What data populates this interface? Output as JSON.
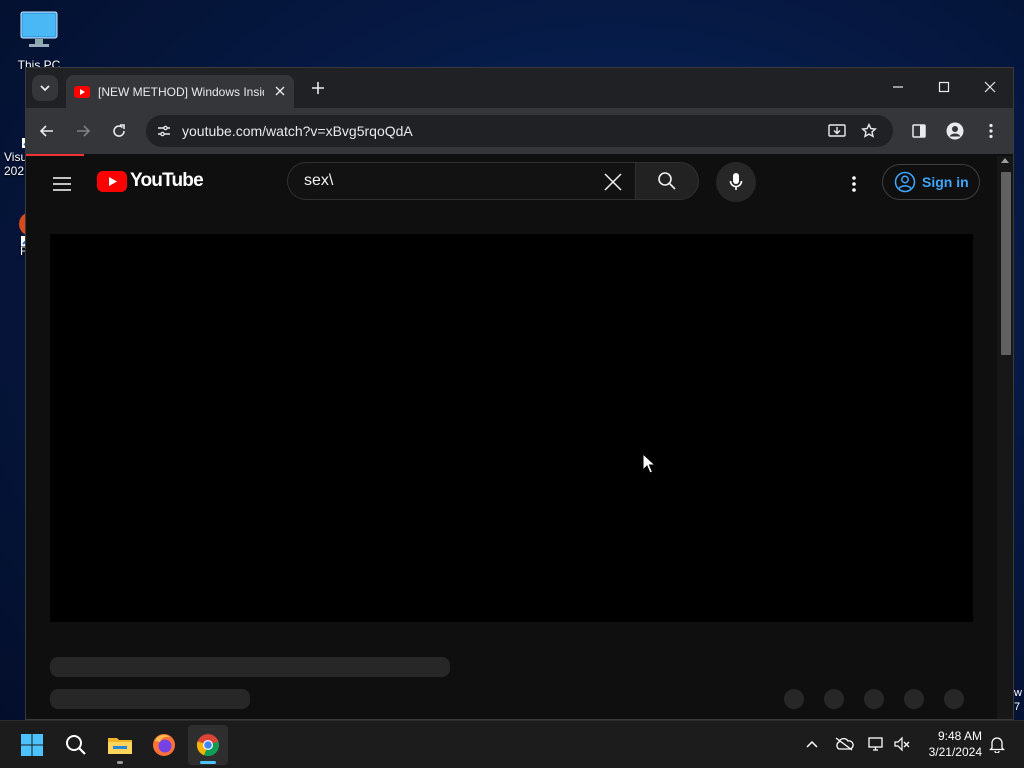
{
  "desktop": {
    "icons": [
      {
        "label": "This PC"
      },
      {
        "label": "Visu 202"
      },
      {
        "label": "F"
      }
    ]
  },
  "browser": {
    "tab": {
      "title": "[NEW METHOD] Windows Insid"
    },
    "address": {
      "url": "youtube.com/watch?v=xBvg5rqoQdA"
    }
  },
  "youtube": {
    "logo_text": "YouTube",
    "search": {
      "value": "sex\\"
    },
    "signin_label": "Sign in",
    "brand_red": "#ff0000",
    "accent_blue": "#3ea6ff"
  },
  "taskbar": {
    "apps": [
      "start-icon",
      "search-icon",
      "file-explorer-icon",
      "firefox-icon",
      "chrome-icon"
    ],
    "clock": {
      "time": "9:48 AM",
      "date": "3/21/2024"
    }
  }
}
